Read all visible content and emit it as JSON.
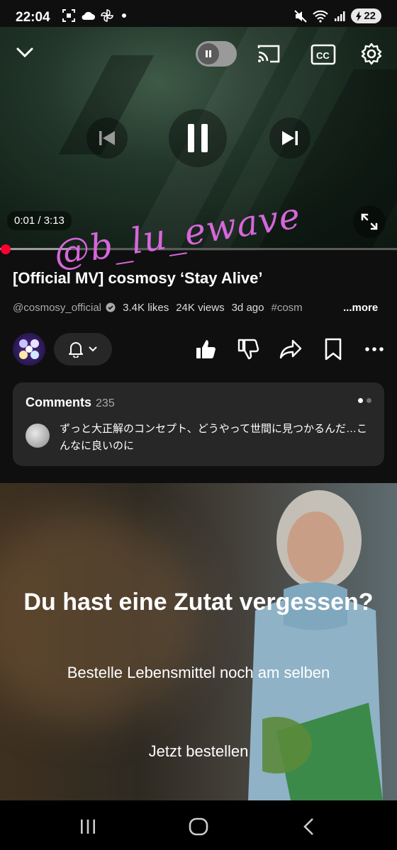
{
  "status_bar": {
    "time": "22:04",
    "battery": "22"
  },
  "player": {
    "time_display": "0:01 / 3:13",
    "progress_fraction": 0.005
  },
  "video": {
    "title": "[Official MV] cosmosy ‘Stay Alive’",
    "channel": "@cosmosy_official",
    "likes": "3.4K likes",
    "views": "24K views",
    "age": "3d ago",
    "hashtag": "#cosm",
    "more_label": "...more"
  },
  "comments": {
    "label": "Comments",
    "count": "235",
    "top_comment": "ずっと大正解のコンセプト、どうやって世間に見つかるんだ…こんなに良いのに"
  },
  "ad": {
    "headline": "Du hast eine Zutat vergessen?",
    "subline": "Bestelle Lebensmittel noch am selben",
    "cta": "Jetzt bestellen"
  },
  "watermark": "@b_lu_ewave",
  "colors": {
    "accent_red": "#ff0033",
    "watermark_pink": "#e06be6",
    "background": "#0f0f0f"
  }
}
